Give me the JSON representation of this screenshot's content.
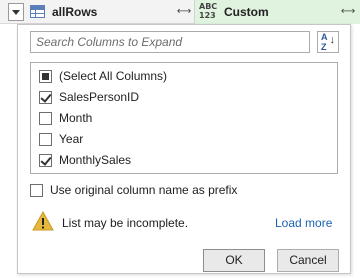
{
  "header": {
    "column_title": "allRows",
    "custom_column_type": "ABC\n123",
    "custom_column_title": "Custom"
  },
  "search": {
    "placeholder": "Search Columns to Expand"
  },
  "columns": [
    {
      "label": "(Select All Columns)",
      "state": "partial"
    },
    {
      "label": "SalesPersonID",
      "state": "checked"
    },
    {
      "label": "Month",
      "state": "unchecked"
    },
    {
      "label": "Year",
      "state": "unchecked"
    },
    {
      "label": "MonthlySales",
      "state": "checked"
    }
  ],
  "prefix_option": {
    "label": "Use original column name as prefix",
    "checked": false
  },
  "warning": {
    "text": "List may be incomplete.",
    "link": "Load more"
  },
  "buttons": {
    "ok": "OK",
    "cancel": "Cancel"
  },
  "colors": {
    "custom_column_bg": "#dff3df",
    "link": "#1b64b5",
    "warning": "#e5b73b"
  }
}
